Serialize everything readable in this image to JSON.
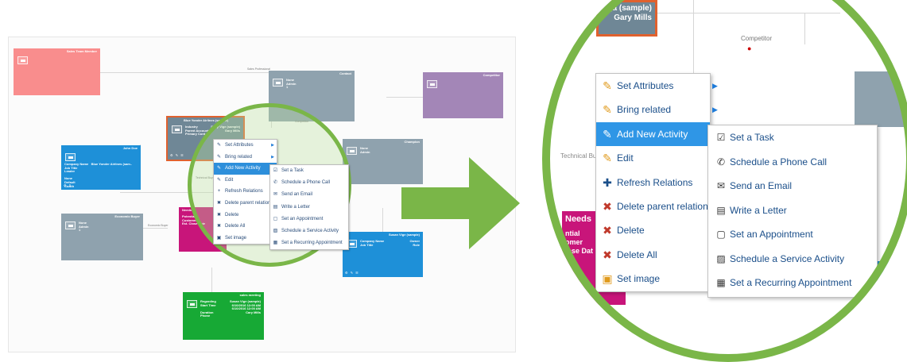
{
  "overview": {
    "cards": {
      "sales_team": {
        "header": "Sales Team Member"
      },
      "contact_top": {
        "header": "Contact",
        "body": "None\nAdmin\n1"
      },
      "competitor": {
        "header": "Competitor"
      },
      "blue_yonder": {
        "header": "Blue Yonder Airlines (sample)",
        "body": "Industry\nParent Account\nPrimary Cont..",
        "right": "Davy Vige (sample)\nGary Mills",
        "owner": "Owner"
      },
      "john_doe": {
        "header": "John Doe",
        "body": "Company Name   Blue Yonder Airlines (sam..\nJob Title\nLeader\n\nNone\nDefault\nCoach"
      },
      "champion": {
        "header": "Champion",
        "body": "None\nAdmin"
      },
      "economic_buyer": {
        "header": "Economic Buyer",
        "body": "None\nAdmin\n1"
      },
      "needs": {
        "header": "Needs",
        "body": "Potential\nCustomer\nEst. Close Date"
      },
      "susan": {
        "header": "Susan Vige (sample)",
        "body": "Company Name\nJob Title",
        "right": "Owner\nRole"
      },
      "sales_meeting": {
        "header": "sales meeting",
        "body": "Regarding\nStart Time\n\nDuration\nPhone",
        "right": "Susan Vige (sample)\n6/10/2016 12:00 AM\n6/10/2016 12:00 AM\nCary Mills"
      }
    },
    "labels": {
      "sales_professional": "Sales Professional",
      "economic_buyer_small": "Economic Buyer",
      "technical_buyer": "Technical Buyer",
      "competitor_small": "Competitor"
    },
    "menu": [
      {
        "icon": "✎",
        "label": "Set Attributes",
        "submenu": true
      },
      {
        "icon": "✎",
        "label": "Bring related",
        "submenu": true
      },
      {
        "icon": "✎",
        "label": "Add New Activity",
        "submenu": false
      },
      {
        "icon": "✎",
        "label": "Edit",
        "submenu": false
      },
      {
        "icon": "+",
        "label": "Refresh Relations",
        "submenu": false
      },
      {
        "icon": "✖",
        "label": "Delete parent relation",
        "submenu": false
      },
      {
        "icon": "✖",
        "label": "Delete",
        "submenu": false
      },
      {
        "icon": "✖",
        "label": "Delete All",
        "submenu": false
      },
      {
        "icon": "▣",
        "label": "Set image",
        "submenu": false
      }
    ],
    "submenu": [
      {
        "icon": "☑",
        "label": "Set a Task"
      },
      {
        "icon": "✆",
        "label": "Schedule a Phone Call"
      },
      {
        "icon": "✉",
        "label": "Send an Email"
      },
      {
        "icon": "▤",
        "label": "Write a Letter"
      },
      {
        "icon": "▢",
        "label": "Set an Appointment"
      },
      {
        "icon": "▨",
        "label": "Schedule a Service Activity"
      },
      {
        "icon": "▦",
        "label": "Set a Recurring Appointment"
      }
    ]
  },
  "zoom": {
    "card_header": "ga (sample)\nGary Mills",
    "competitor_label": "Competitor",
    "technical_label": "Technical Bu",
    "needs_header": "Needs",
    "needs_body": "ntial\nomer\nlose Dat",
    "menu": [
      {
        "icon": "✎",
        "label": "Set Attributes",
        "submenu": true
      },
      {
        "icon": "✎",
        "label": "Bring related",
        "submenu": true
      },
      {
        "icon": "✎",
        "label": "Add New Activity",
        "submenu": false
      },
      {
        "icon": "✎",
        "label": "Edit",
        "submenu": false
      },
      {
        "icon": "✚",
        "label": "Refresh Relations",
        "submenu": false
      },
      {
        "icon": "✖",
        "label": "Delete parent relation",
        "submenu": false
      },
      {
        "icon": "✖",
        "label": "Delete",
        "submenu": false
      },
      {
        "icon": "✖",
        "label": "Delete All",
        "submenu": false
      },
      {
        "icon": "▣",
        "label": "Set image",
        "submenu": false
      }
    ],
    "submenu": [
      {
        "icon": "☑",
        "label": "Set a Task"
      },
      {
        "icon": "✆",
        "label": "Schedule a Phone Call"
      },
      {
        "icon": "✉",
        "label": "Send an Email"
      },
      {
        "icon": "▤",
        "label": "Write a Letter"
      },
      {
        "icon": "▢",
        "label": "Set an Appointment"
      },
      {
        "icon": "▨",
        "label": "Schedule a Service Activity"
      },
      {
        "icon": "▦",
        "label": "Set a Recurring Appointment"
      }
    ]
  },
  "colors": {
    "accent_green": "#7ab648",
    "menu_highlight": "#2f96e6",
    "menu_text": "#1b4f8a"
  }
}
